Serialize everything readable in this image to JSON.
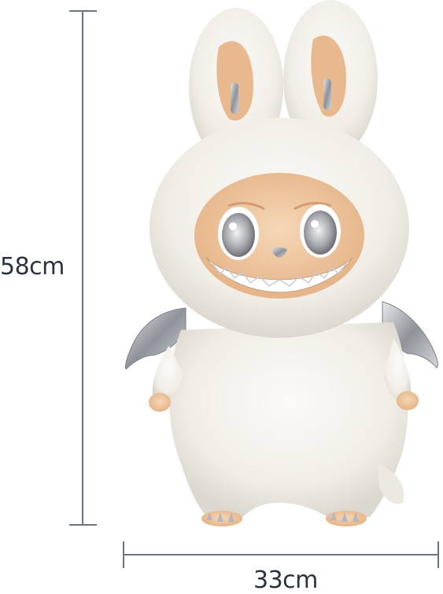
{
  "measurements": {
    "height_label": "58cm",
    "width_label": "33cm"
  },
  "figure": {
    "icon": "plush-toy-figure"
  },
  "colors": {
    "line": "#6b7482",
    "text": "#2c3340",
    "fur": "#f2f0ea",
    "skin": "#efc8a0",
    "ear_inner": "#e8b88f",
    "silver": "#b9bcc2"
  }
}
